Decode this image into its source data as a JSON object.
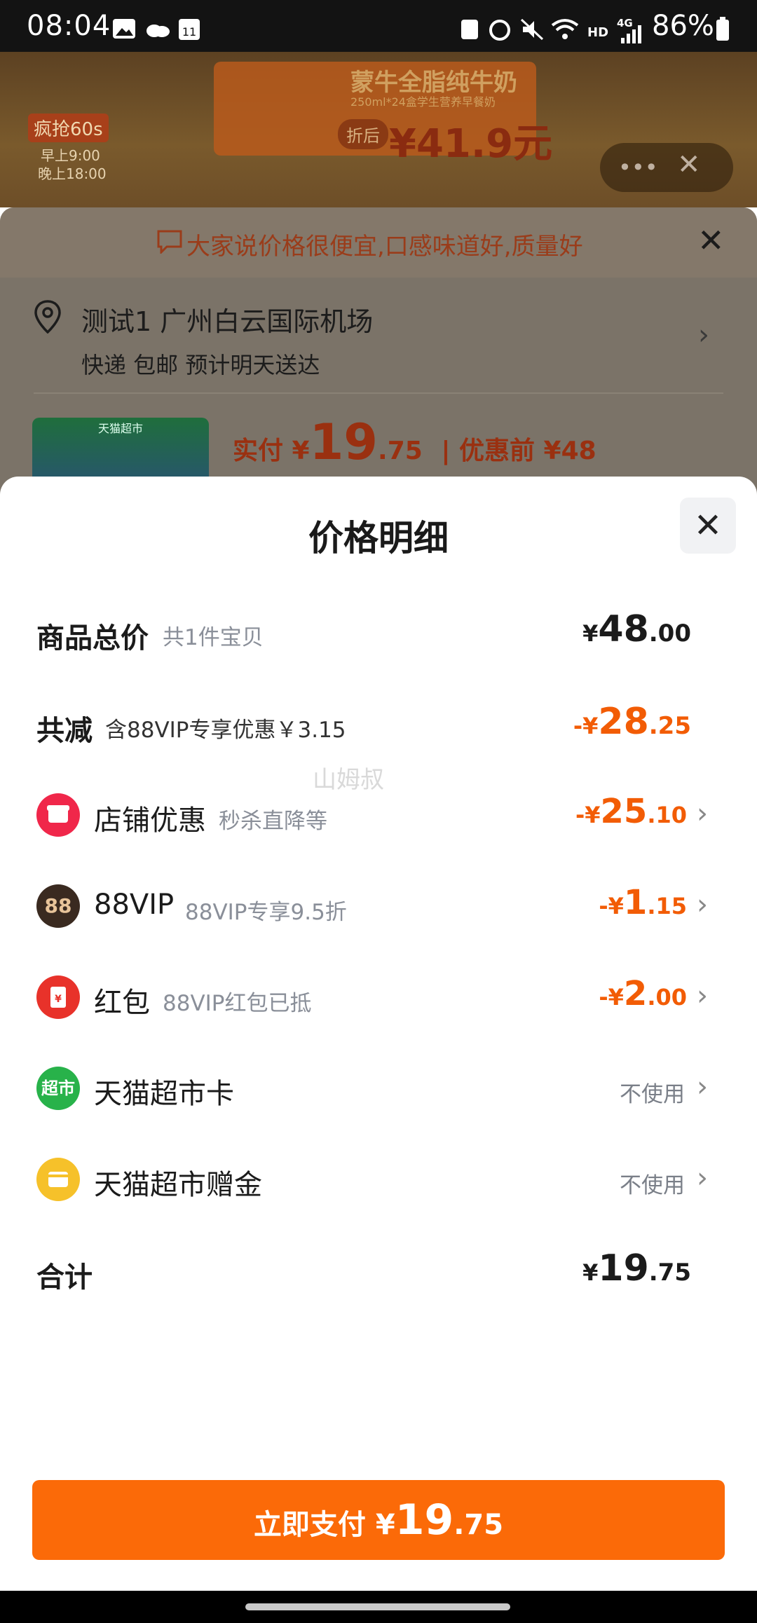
{
  "status_bar": {
    "time": "08:04",
    "battery": "86%",
    "network": "4G",
    "hd": "HD"
  },
  "background": {
    "promo_title": "蒙牛全脂纯牛奶",
    "promo_subtitle": "250ml*24盒学生营养早餐奶",
    "promo_price": "¥41.9元",
    "promo_tag": "折后",
    "grab_label": "疯抢60s",
    "morning": "早上9:00",
    "evening": "晚上18:00"
  },
  "sheet": {
    "notice": "大家说价格很便宜,口感味道好,质量好",
    "address_line1": "测试1 广州白云国际机场",
    "address_line2": "快递 包邮 预计明天送达",
    "thumb_label": "天猫超市",
    "paid_prefix": "实付 ¥",
    "paid_int": "19",
    "paid_dec": ".75",
    "before_label": "| 优惠前 ¥48"
  },
  "modal": {
    "title": "价格明细",
    "watermark": "山姆叔",
    "rows": {
      "total": {
        "label": "商品总价",
        "sub": "共1件宝贝",
        "prefix": "¥",
        "int": "48",
        "dec": ".00"
      },
      "reduce": {
        "label": "共减",
        "sub": "含88VIP专享优惠￥3.15",
        "prefix": "-¥",
        "int": "28",
        "dec": ".25"
      },
      "shop": {
        "label": "店铺优惠",
        "sub": "秒杀直降等",
        "prefix": "-¥",
        "int": "25",
        "dec": ".10"
      },
      "vip": {
        "label": "88VIP",
        "sub": "88VIP专享9.5折",
        "prefix": "-¥",
        "int": "1",
        "dec": ".15",
        "icon_text": "88"
      },
      "redpacket": {
        "label": "红包",
        "sub": "88VIP红包已抵",
        "prefix": "-¥",
        "int": "2",
        "dec": ".00"
      },
      "tmall_card": {
        "label": "天猫超市卡",
        "value": "不使用",
        "icon_text": "超市"
      },
      "tmall_gift": {
        "label": "天猫超市赠金",
        "value": "不使用"
      },
      "sum": {
        "label": "合计",
        "prefix": "¥",
        "int": "19",
        "dec": ".75"
      }
    }
  },
  "pay_button": {
    "label": "立即支付 ¥",
    "int": "19",
    "dec": ".75"
  },
  "colors": {
    "accent_orange": "#f25c05",
    "pay_button": "#fb6a08",
    "shop_icon": "#f0274a",
    "vip_icon": "#3a2a20",
    "redpacket_icon": "#e8322a",
    "tmall_card_icon": "#28b24a",
    "tmall_gift_icon": "#f6c12a"
  }
}
